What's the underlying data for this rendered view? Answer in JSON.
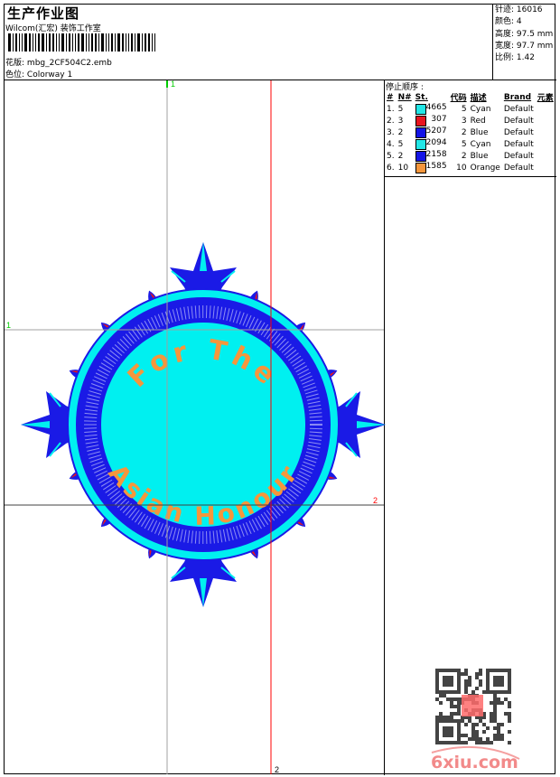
{
  "header": {
    "title": "生产作业图",
    "company": "Wilcom(汇宏) 装饰工作室",
    "design_label": "花版:",
    "design_value": "mbg_2CF504C2.emb",
    "colorway_label": "色位:",
    "colorway_value": "Colorway 1"
  },
  "stats": {
    "stitches": "针迹: 16016",
    "colors": "颜色: 4",
    "height": "高度: 97.5 mm",
    "width": "宽度: 97.7 mm",
    "scale": "比例: 1.42"
  },
  "stop_sequence": {
    "title": "停止顺序 :",
    "headers": [
      "#",
      "N#",
      "St.",
      "代码",
      "描述",
      "Brand",
      "元素"
    ],
    "rows": [
      {
        "idx": "1.",
        "n": "5",
        "color": "#22e6e6",
        "st": "4665",
        "code": "5",
        "desc": "Cyan",
        "brand": "Default"
      },
      {
        "idx": "2.",
        "n": "3",
        "color": "#e8141e",
        "st": "307",
        "code": "3",
        "desc": "Red",
        "brand": "Default"
      },
      {
        "idx": "3.",
        "n": "2",
        "color": "#1414e6",
        "st": "5207",
        "code": "2",
        "desc": "Blue",
        "brand": "Default"
      },
      {
        "idx": "4.",
        "n": "5",
        "color": "#22e6e6",
        "st": "2094",
        "code": "5",
        "desc": "Cyan",
        "brand": "Default"
      },
      {
        "idx": "5.",
        "n": "2",
        "color": "#1414e6",
        "st": "2158",
        "code": "2",
        "desc": "Blue",
        "brand": "Default"
      },
      {
        "idx": "6.",
        "n": "10",
        "color": "#f5963c",
        "st": "1585",
        "code": "10",
        "desc": "Orange",
        "brand": "Default"
      }
    ]
  },
  "canvas": {
    "guide_labels": {
      "green_v": "1",
      "green_h": "1",
      "red_h": "2",
      "red_v": "2"
    },
    "top_text": "For The",
    "bottom_text": "Asian Honour"
  },
  "watermark": {
    "site": "6xiu.com",
    "seal": "以图版"
  },
  "colors": {
    "cyan": "#00f0f0",
    "blue": "#1a1ae6",
    "orange": "#f5963c",
    "red": "#e8141e",
    "green_guide": "#00cc00",
    "red_guide": "#ff0000"
  }
}
